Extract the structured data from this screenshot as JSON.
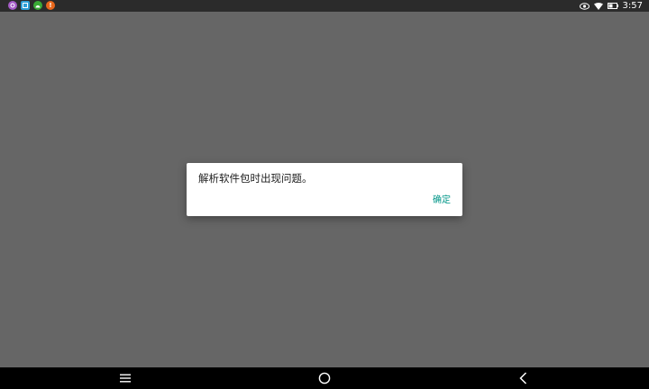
{
  "status_bar": {
    "time": "3:57",
    "notification_icons": [
      {
        "name": "app-notification-icon",
        "color": "#a55cc7",
        "glyph": ""
      },
      {
        "name": "image-notification-icon",
        "color": "#2e9fd6",
        "glyph": ""
      },
      {
        "name": "android-notification-icon",
        "color": "#3aaa35",
        "glyph": ""
      },
      {
        "name": "alert-notification-icon",
        "color": "#e8671b",
        "glyph": "!"
      }
    ],
    "system_icons": [
      "eye-icon",
      "wifi-icon",
      "battery-icon"
    ]
  },
  "dialog": {
    "message": "解析软件包时出现问题。",
    "confirm_label": "确定",
    "accent_color": "#009688"
  },
  "nav_bar": {
    "buttons": [
      "menu-icon",
      "home-icon",
      "back-icon"
    ]
  }
}
